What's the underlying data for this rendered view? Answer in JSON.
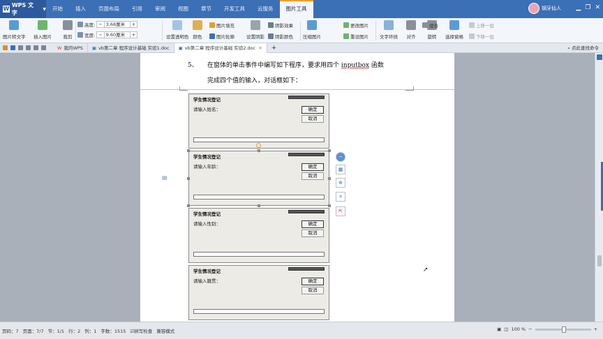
{
  "app": {
    "name": "WPS 文字",
    "user": "钢牙仙人"
  },
  "colors": {
    "accent": "#3b6fb6",
    "ribbon_bg": "#f3f6fa",
    "active_tab_marker": "#f0a030",
    "workspace_bg": "#a9b0ba"
  },
  "menu": {
    "tabs": [
      "开始",
      "插入",
      "页面布局",
      "引用",
      "审阅",
      "视图",
      "章节",
      "开发工具",
      "云服务",
      "图片工具"
    ],
    "active": "图片工具"
  },
  "ribbon": {
    "convert_text": "图片转文字",
    "insert_image": "插入图片",
    "crop": "裁剪",
    "height_label": "高度:",
    "height_value": "3.68厘米",
    "width_label": "宽度:",
    "width_value": "9.60厘米",
    "set_transparent": "设置透明色",
    "color": "颜色",
    "image_fill": "图片填充",
    "image_outline": "图片轮廓",
    "shadow_effect": "阴影效果",
    "shadow_color": "阴影颜色",
    "set_shadow": "设置阴影",
    "compress": "压缩图片",
    "change_image": "更改图片",
    "reset_image": "重设图片",
    "text_wrap": "文字环绕",
    "align": "对齐",
    "rotate": "旋转",
    "group": "组合",
    "selection_pane": "选择窗格",
    "bring_forward": "上移一层",
    "send_backward": "下移一层"
  },
  "tabs_bar": {
    "tabs": [
      {
        "label": "我的WPS",
        "active": false
      },
      {
        "label": "vb第二章 程序设计基础 实验1.doc",
        "active": false
      },
      {
        "label": "vb第二章 程序设计基础 实验2.doc",
        "active": true
      }
    ],
    "add": "+",
    "search_command": "点此查找命令"
  },
  "document": {
    "step_number": "5、",
    "line1_prefix": "在窗体的单击事件中编写如下程序，要求用四个",
    "line1_keyword": "inputbox",
    "line1_suffix": "函数",
    "line2": "完成四个值的输入，对话框如下：",
    "dialogs": [
      {
        "title": "学生情况登记",
        "prompt": "请输入姓名：",
        "ok": "确定",
        "cancel": "取消"
      },
      {
        "title": "学生情况登记",
        "prompt": "请输入年龄：",
        "ok": "确定",
        "cancel": "取消"
      },
      {
        "title": "学生情况登记",
        "prompt": "请输入性别：",
        "ok": "确定",
        "cancel": "取消"
      },
      {
        "title": "学生情况登记",
        "prompt": "请输入籍贯：",
        "ok": "确定",
        "cancel": "取消"
      }
    ]
  },
  "status": {
    "page_no": "页码：7",
    "pages": "页面：7/7",
    "section": "节：1/1",
    "row": "行：2",
    "col": "列：1",
    "word_count": "字数：1515",
    "spell_check": "拼写检查",
    "compat_mode": "兼容模式",
    "zoom": "100 %"
  }
}
